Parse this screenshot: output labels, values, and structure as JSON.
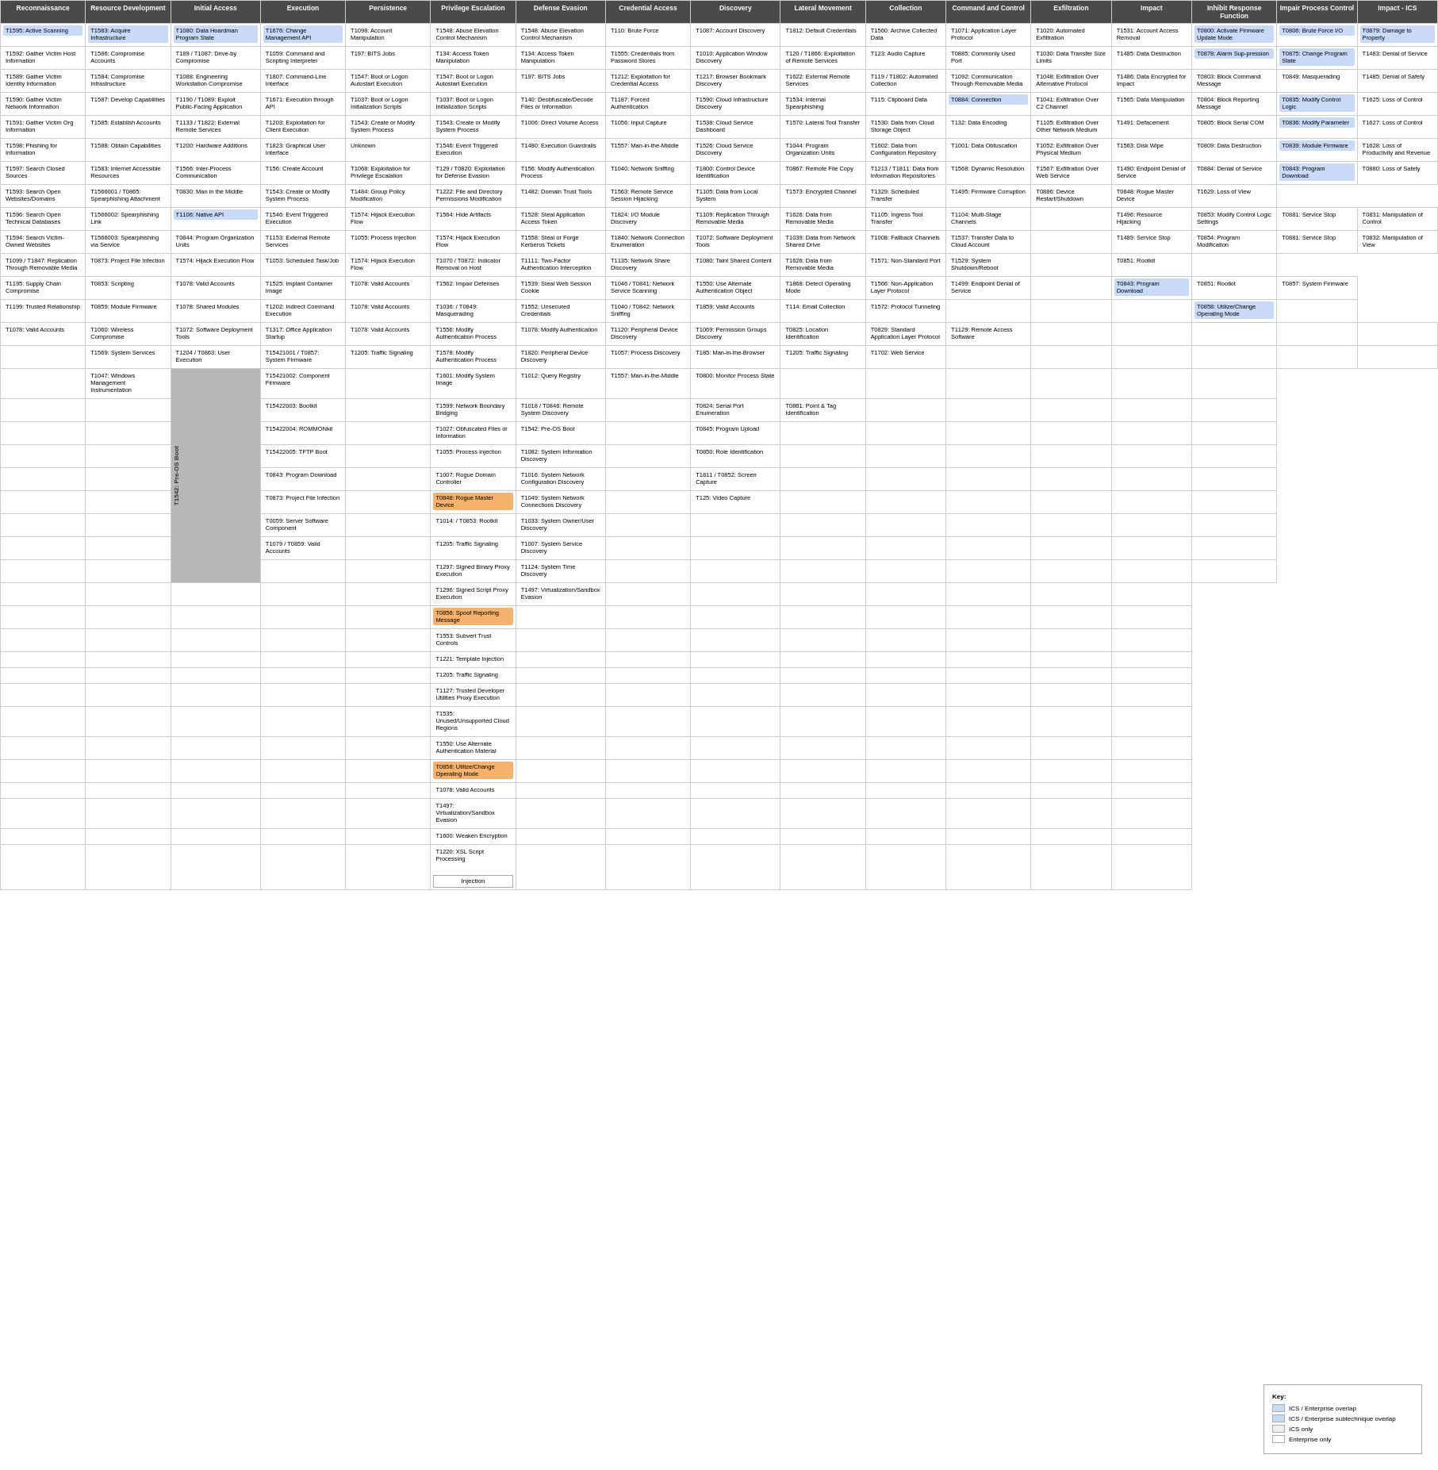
{
  "headers": {
    "recon": "Reconnaissance",
    "resource": "Resource Development",
    "initial": "Initial Access",
    "execution": "Execution",
    "persistence": "Persistence",
    "priv": "Privilege Escalation",
    "defense": "Defense Evasion",
    "cred": "Credential Access",
    "discovery": "Discovery",
    "lateral": "Lateral Movement",
    "collection": "Collection",
    "cc": "Command and Control",
    "exfil": "Exfiltration",
    "impact": "Impact",
    "inhibit": "Inhibit Response Function",
    "impair": "Impair Process Control",
    "impact_ics": "Impact - ICS"
  },
  "key": {
    "title": "Key:",
    "items": [
      {
        "label": "ICS / Enterprise overlap",
        "color": "blue"
      },
      {
        "label": "ICS / Enterprise subtechnique overlap",
        "color": "light-blue"
      },
      {
        "label": "ICS only",
        "color": "gray"
      },
      {
        "label": "Enterprise only",
        "color": "white"
      }
    ]
  }
}
